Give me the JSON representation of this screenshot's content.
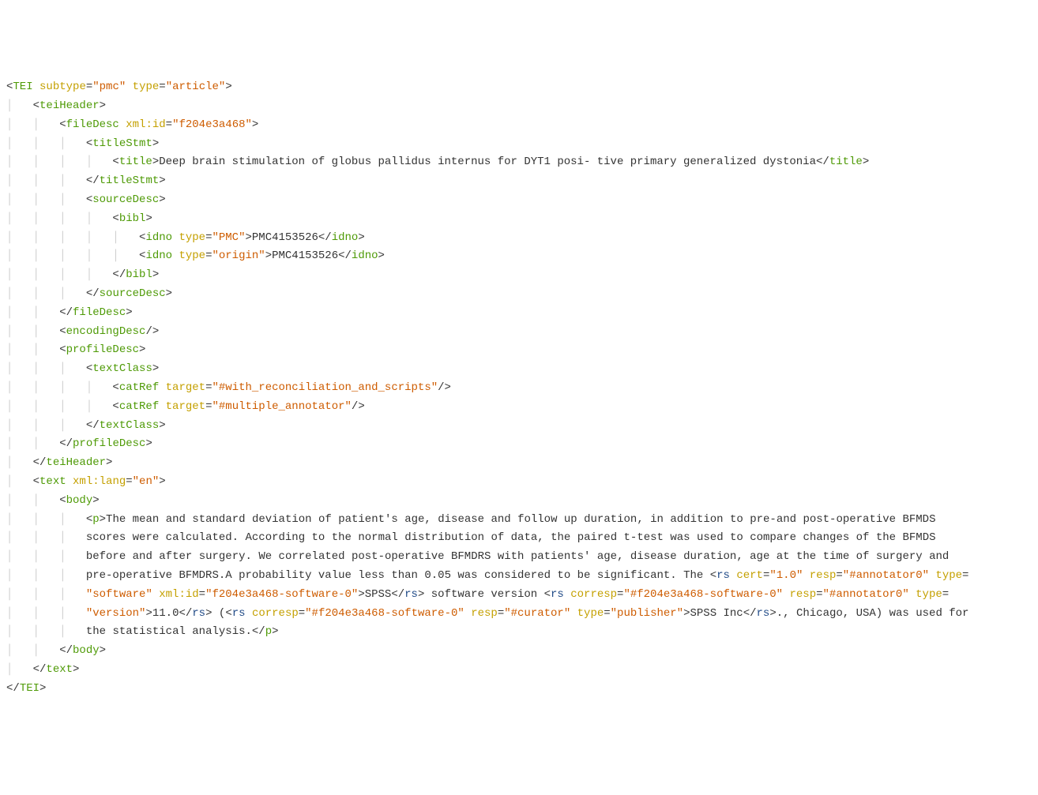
{
  "lines": [
    {
      "indent": 0,
      "segments": [
        {
          "t": "punct",
          "v": "<"
        },
        {
          "t": "tag",
          "v": "TEI"
        },
        {
          "t": "text",
          "v": " "
        },
        {
          "t": "attr",
          "v": "subtype"
        },
        {
          "t": "punct",
          "v": "="
        },
        {
          "t": "val",
          "v": "\"pmc\""
        },
        {
          "t": "text",
          "v": " "
        },
        {
          "t": "attr",
          "v": "type"
        },
        {
          "t": "punct",
          "v": "="
        },
        {
          "t": "val",
          "v": "\"article\""
        },
        {
          "t": "punct",
          "v": ">"
        }
      ]
    },
    {
      "indent": 1,
      "segments": [
        {
          "t": "punct",
          "v": "<"
        },
        {
          "t": "tag",
          "v": "teiHeader"
        },
        {
          "t": "punct",
          "v": ">"
        }
      ]
    },
    {
      "indent": 2,
      "segments": [
        {
          "t": "punct",
          "v": "<"
        },
        {
          "t": "tag",
          "v": "fileDesc"
        },
        {
          "t": "text",
          "v": " "
        },
        {
          "t": "attr",
          "v": "xml:id"
        },
        {
          "t": "punct",
          "v": "="
        },
        {
          "t": "val",
          "v": "\"f204e3a468\""
        },
        {
          "t": "punct",
          "v": ">"
        }
      ]
    },
    {
      "indent": 3,
      "segments": [
        {
          "t": "punct",
          "v": "<"
        },
        {
          "t": "tag",
          "v": "titleStmt"
        },
        {
          "t": "punct",
          "v": ">"
        }
      ]
    },
    {
      "indent": 4,
      "segments": [
        {
          "t": "punct",
          "v": "<"
        },
        {
          "t": "tag",
          "v": "title"
        },
        {
          "t": "punct",
          "v": ">"
        },
        {
          "t": "text",
          "v": "Deep brain stimulation of globus pallidus internus for DYT1 posi- tive primary generalized dystonia"
        },
        {
          "t": "punct",
          "v": "</"
        },
        {
          "t": "tag",
          "v": "title"
        },
        {
          "t": "punct",
          "v": ">"
        }
      ]
    },
    {
      "indent": 3,
      "segments": [
        {
          "t": "punct",
          "v": "</"
        },
        {
          "t": "tag",
          "v": "titleStmt"
        },
        {
          "t": "punct",
          "v": ">"
        }
      ]
    },
    {
      "indent": 3,
      "segments": [
        {
          "t": "punct",
          "v": "<"
        },
        {
          "t": "tag",
          "v": "sourceDesc"
        },
        {
          "t": "punct",
          "v": ">"
        }
      ]
    },
    {
      "indent": 4,
      "segments": [
        {
          "t": "punct",
          "v": "<"
        },
        {
          "t": "tag",
          "v": "bibl"
        },
        {
          "t": "punct",
          "v": ">"
        }
      ]
    },
    {
      "indent": 5,
      "segments": [
        {
          "t": "punct",
          "v": "<"
        },
        {
          "t": "tag",
          "v": "idno"
        },
        {
          "t": "text",
          "v": " "
        },
        {
          "t": "attr",
          "v": "type"
        },
        {
          "t": "punct",
          "v": "="
        },
        {
          "t": "val",
          "v": "\"PMC\""
        },
        {
          "t": "punct",
          "v": ">"
        },
        {
          "t": "text",
          "v": "PMC4153526"
        },
        {
          "t": "punct",
          "v": "</"
        },
        {
          "t": "tag",
          "v": "idno"
        },
        {
          "t": "punct",
          "v": ">"
        }
      ]
    },
    {
      "indent": 5,
      "segments": [
        {
          "t": "punct",
          "v": "<"
        },
        {
          "t": "tag",
          "v": "idno"
        },
        {
          "t": "text",
          "v": " "
        },
        {
          "t": "attr",
          "v": "type"
        },
        {
          "t": "punct",
          "v": "="
        },
        {
          "t": "val",
          "v": "\"origin\""
        },
        {
          "t": "punct",
          "v": ">"
        },
        {
          "t": "text",
          "v": "PMC4153526"
        },
        {
          "t": "punct",
          "v": "</"
        },
        {
          "t": "tag",
          "v": "idno"
        },
        {
          "t": "punct",
          "v": ">"
        }
      ]
    },
    {
      "indent": 4,
      "segments": [
        {
          "t": "punct",
          "v": "</"
        },
        {
          "t": "tag",
          "v": "bibl"
        },
        {
          "t": "punct",
          "v": ">"
        }
      ]
    },
    {
      "indent": 3,
      "segments": [
        {
          "t": "punct",
          "v": "</"
        },
        {
          "t": "tag",
          "v": "sourceDesc"
        },
        {
          "t": "punct",
          "v": ">"
        }
      ]
    },
    {
      "indent": 2,
      "segments": [
        {
          "t": "punct",
          "v": "</"
        },
        {
          "t": "tag",
          "v": "fileDesc"
        },
        {
          "t": "punct",
          "v": ">"
        }
      ]
    },
    {
      "indent": 2,
      "segments": [
        {
          "t": "punct",
          "v": "<"
        },
        {
          "t": "tag",
          "v": "encodingDesc"
        },
        {
          "t": "punct",
          "v": "/>"
        }
      ]
    },
    {
      "indent": 2,
      "segments": [
        {
          "t": "punct",
          "v": "<"
        },
        {
          "t": "tag",
          "v": "profileDesc"
        },
        {
          "t": "punct",
          "v": ">"
        }
      ]
    },
    {
      "indent": 3,
      "segments": [
        {
          "t": "punct",
          "v": "<"
        },
        {
          "t": "tag",
          "v": "textClass"
        },
        {
          "t": "punct",
          "v": ">"
        }
      ]
    },
    {
      "indent": 4,
      "segments": [
        {
          "t": "punct",
          "v": "<"
        },
        {
          "t": "tag",
          "v": "catRef"
        },
        {
          "t": "text",
          "v": " "
        },
        {
          "t": "attr",
          "v": "target"
        },
        {
          "t": "punct",
          "v": "="
        },
        {
          "t": "val",
          "v": "\"#with_reconciliation_and_scripts\""
        },
        {
          "t": "punct",
          "v": "/>"
        }
      ]
    },
    {
      "indent": 4,
      "segments": [
        {
          "t": "punct",
          "v": "<"
        },
        {
          "t": "tag",
          "v": "catRef"
        },
        {
          "t": "text",
          "v": " "
        },
        {
          "t": "attr",
          "v": "target"
        },
        {
          "t": "punct",
          "v": "="
        },
        {
          "t": "val",
          "v": "\"#multiple_annotator\""
        },
        {
          "t": "punct",
          "v": "/>"
        }
      ]
    },
    {
      "indent": 3,
      "segments": [
        {
          "t": "punct",
          "v": "</"
        },
        {
          "t": "tag",
          "v": "textClass"
        },
        {
          "t": "punct",
          "v": ">"
        }
      ]
    },
    {
      "indent": 2,
      "segments": [
        {
          "t": "punct",
          "v": "</"
        },
        {
          "t": "tag",
          "v": "profileDesc"
        },
        {
          "t": "punct",
          "v": ">"
        }
      ]
    },
    {
      "indent": 1,
      "segments": [
        {
          "t": "punct",
          "v": "</"
        },
        {
          "t": "tag",
          "v": "teiHeader"
        },
        {
          "t": "punct",
          "v": ">"
        }
      ]
    },
    {
      "indent": 1,
      "segments": [
        {
          "t": "punct",
          "v": "<"
        },
        {
          "t": "tag",
          "v": "text"
        },
        {
          "t": "text",
          "v": " "
        },
        {
          "t": "attr",
          "v": "xml:lang"
        },
        {
          "t": "punct",
          "v": "="
        },
        {
          "t": "val",
          "v": "\"en\""
        },
        {
          "t": "punct",
          "v": ">"
        }
      ]
    },
    {
      "indent": 2,
      "segments": [
        {
          "t": "punct",
          "v": "<"
        },
        {
          "t": "tag",
          "v": "body"
        },
        {
          "t": "punct",
          "v": ">"
        }
      ]
    },
    {
      "indent": 3,
      "wrap": true,
      "segments": [
        {
          "t": "punct",
          "v": "<"
        },
        {
          "t": "tag",
          "v": "p"
        },
        {
          "t": "punct",
          "v": ">"
        },
        {
          "t": "text",
          "v": "The mean and standard deviation of patient's age, disease and follow up duration, in addition to pre-and post-operative BFMDS scores were calculated. According to the normal distribution of data, the paired t-test was used to compare changes of the BFMDS before and after surgery. We correlated post-operative BFMDRS with patients' age, disease duration, age at the time of surgery and pre-operative BFMDRS.A probability value less than 0.05 was considered to be significant. The "
        },
        {
          "t": "punct",
          "v": "<"
        },
        {
          "t": "rs",
          "v": "rs"
        },
        {
          "t": "text",
          "v": " "
        },
        {
          "t": "attr",
          "v": "cert"
        },
        {
          "t": "punct",
          "v": "="
        },
        {
          "t": "val",
          "v": "\"1.0\""
        },
        {
          "t": "text",
          "v": " "
        },
        {
          "t": "attr",
          "v": "resp"
        },
        {
          "t": "punct",
          "v": "="
        },
        {
          "t": "val",
          "v": "\"#annotator0\""
        },
        {
          "t": "text",
          "v": " "
        },
        {
          "t": "attr",
          "v": "type"
        },
        {
          "t": "punct",
          "v": "="
        },
        {
          "t": "val",
          "v": "\"software\""
        },
        {
          "t": "text",
          "v": " "
        },
        {
          "t": "attr",
          "v": "xml:id"
        },
        {
          "t": "punct",
          "v": "="
        },
        {
          "t": "val",
          "v": "\"f204e3a468-software-0\""
        },
        {
          "t": "punct",
          "v": ">"
        },
        {
          "t": "text",
          "v": "SPSS"
        },
        {
          "t": "punct",
          "v": "</"
        },
        {
          "t": "rs",
          "v": "rs"
        },
        {
          "t": "punct",
          "v": ">"
        },
        {
          "t": "text",
          "v": " software version "
        },
        {
          "t": "punct",
          "v": "<"
        },
        {
          "t": "rs",
          "v": "rs"
        },
        {
          "t": "text",
          "v": " "
        },
        {
          "t": "attr",
          "v": "corresp"
        },
        {
          "t": "punct",
          "v": "="
        },
        {
          "t": "val",
          "v": "\"#f204e3a468-software-0\""
        },
        {
          "t": "text",
          "v": " "
        },
        {
          "t": "attr",
          "v": "resp"
        },
        {
          "t": "punct",
          "v": "="
        },
        {
          "t": "val",
          "v": "\"#annotator0\""
        },
        {
          "t": "text",
          "v": " "
        },
        {
          "t": "attr",
          "v": "type"
        },
        {
          "t": "punct",
          "v": "="
        },
        {
          "t": "val",
          "v": "\"version\""
        },
        {
          "t": "punct",
          "v": ">"
        },
        {
          "t": "text",
          "v": "11.0"
        },
        {
          "t": "punct",
          "v": "</"
        },
        {
          "t": "rs",
          "v": "rs"
        },
        {
          "t": "punct",
          "v": ">"
        },
        {
          "t": "text",
          "v": " ("
        },
        {
          "t": "punct",
          "v": "<"
        },
        {
          "t": "rs",
          "v": "rs"
        },
        {
          "t": "text",
          "v": " "
        },
        {
          "t": "attr",
          "v": "corresp"
        },
        {
          "t": "punct",
          "v": "="
        },
        {
          "t": "val",
          "v": "\"#f204e3a468-software-0\""
        },
        {
          "t": "text",
          "v": " "
        },
        {
          "t": "attr",
          "v": "resp"
        },
        {
          "t": "punct",
          "v": "="
        },
        {
          "t": "val",
          "v": "\"#curator\""
        },
        {
          "t": "text",
          "v": " "
        },
        {
          "t": "attr",
          "v": "type"
        },
        {
          "t": "punct",
          "v": "="
        },
        {
          "t": "val",
          "v": "\"publisher\""
        },
        {
          "t": "punct",
          "v": ">"
        },
        {
          "t": "text",
          "v": "SPSS Inc"
        },
        {
          "t": "punct",
          "v": "</"
        },
        {
          "t": "rs",
          "v": "rs"
        },
        {
          "t": "punct",
          "v": ">"
        },
        {
          "t": "text",
          "v": "., Chicago, USA) was used for the statistical analysis."
        },
        {
          "t": "punct",
          "v": "</"
        },
        {
          "t": "tag",
          "v": "p"
        },
        {
          "t": "punct",
          "v": ">"
        }
      ]
    },
    {
      "indent": 2,
      "segments": [
        {
          "t": "punct",
          "v": "</"
        },
        {
          "t": "tag",
          "v": "body"
        },
        {
          "t": "punct",
          "v": ">"
        }
      ]
    },
    {
      "indent": 1,
      "segments": [
        {
          "t": "punct",
          "v": "</"
        },
        {
          "t": "tag",
          "v": "text"
        },
        {
          "t": "punct",
          "v": ">"
        }
      ]
    },
    {
      "indent": 0,
      "segments": [
        {
          "t": "punct",
          "v": "</"
        },
        {
          "t": "tag",
          "v": "TEI"
        },
        {
          "t": "punct",
          "v": ">"
        }
      ]
    }
  ],
  "colors": {
    "tag": "#4e9a06",
    "rs": "#204a87",
    "attr": "#c4a000",
    "val": "#ce5c00",
    "guide": "#cccccc",
    "text": "#333333"
  },
  "indent_unit": "   "
}
